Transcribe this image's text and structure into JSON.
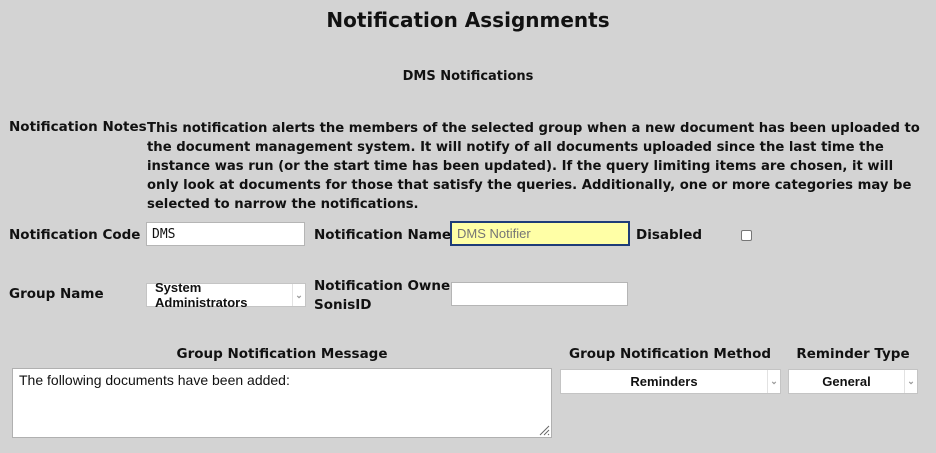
{
  "page": {
    "title": "Notification Assignments",
    "subtitle": "DMS Notifications"
  },
  "notes": {
    "label": "Notification Notes",
    "text": "This notification alerts the members of the selected group when a new document has been uploaded to the document management system. It will notify of all documents uploaded since the last time the instance was run (or the start time has been updated). If the query limiting items are chosen, it will only look at documents for those that satisfy the queries. Additionally, one or more categories may be selected to narrow the notifications."
  },
  "code": {
    "label": "Notification Code",
    "value": "DMS"
  },
  "name": {
    "label": "Notification Name",
    "placeholder": "DMS Notifier"
  },
  "disabled": {
    "label": "Disabled",
    "checked": false
  },
  "group": {
    "label": "Group Name",
    "selected": "System Administrators"
  },
  "owner": {
    "label_line1": "Notification Owner",
    "label_line2": "SonisID",
    "value": ""
  },
  "message": {
    "label": "Group Notification Message",
    "value": "The following documents have been added:"
  },
  "method": {
    "label": "Group Notification Method",
    "selected": "Reminders"
  },
  "reminder": {
    "label": "Reminder Type",
    "selected": "General"
  }
}
